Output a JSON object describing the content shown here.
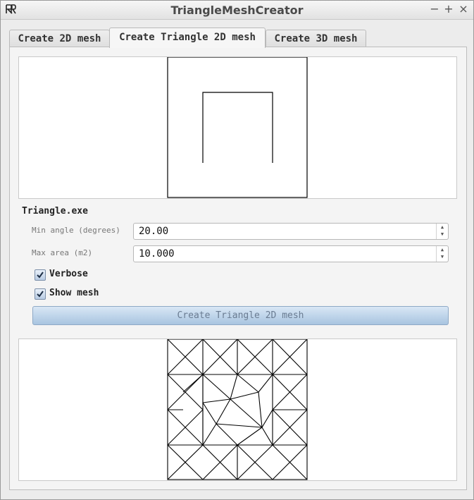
{
  "window": {
    "title": "TriangleMeshCreator",
    "minimize_label": "−",
    "maximize_label": "+",
    "close_label": "×"
  },
  "tabs": [
    {
      "label": "Create 2D mesh"
    },
    {
      "label": "Create Triangle 2D mesh"
    },
    {
      "label": "Create 3D mesh"
    }
  ],
  "triangle": {
    "section_title": "Triangle.exe",
    "min_angle_label": "Min angle (degrees)",
    "min_angle_value": "20.00",
    "max_area_label": "Max area (m2)",
    "max_area_value": "10.000",
    "verbose_label": "Verbose",
    "verbose_checked": true,
    "show_mesh_label": "Show mesh",
    "show_mesh_checked": true,
    "create_button_label": "Create Triangle 2D mesh"
  },
  "icons": {
    "app": "app-icon",
    "spin_up": "▲",
    "spin_down": "▼"
  },
  "colors": {
    "button_gradient_top": "#d9e7f5",
    "button_gradient_bottom": "#a8c4e0",
    "check_border": "#7a8ea8"
  }
}
